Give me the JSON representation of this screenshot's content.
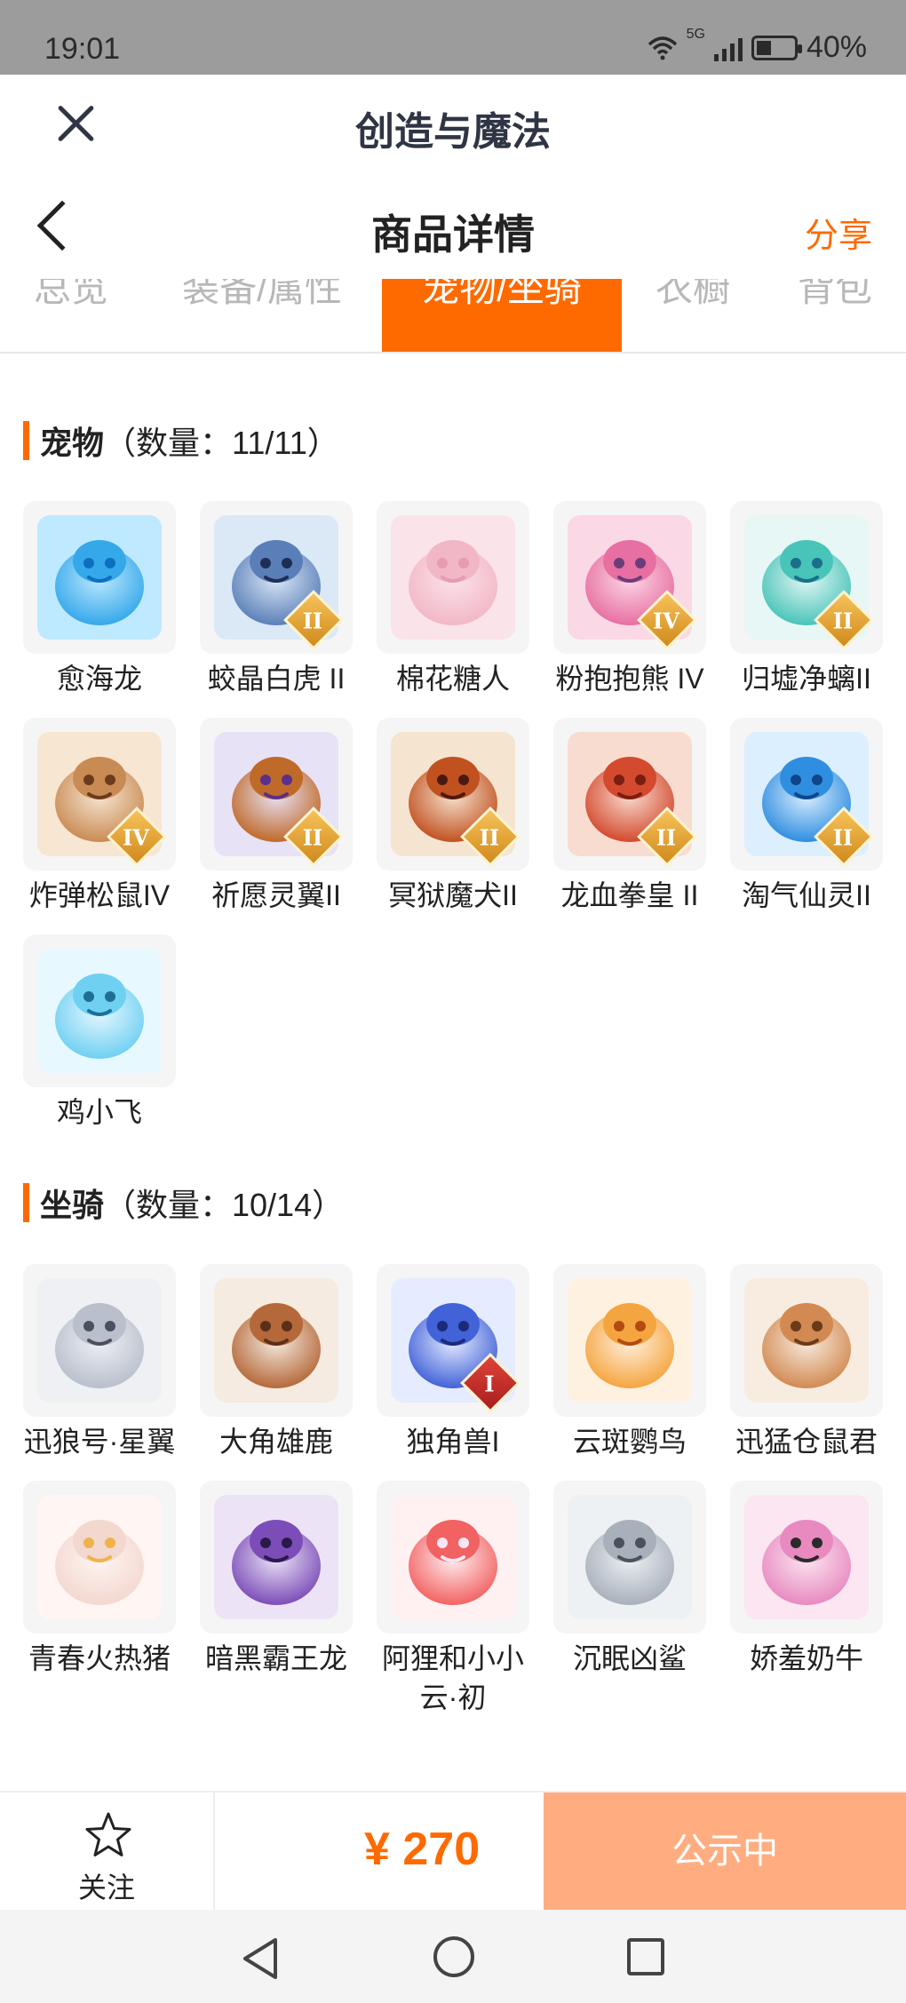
{
  "status_bar": {
    "time": "19:01",
    "network": "5G",
    "battery": "40%"
  },
  "app_header": {
    "title": "创造与魔法",
    "close_icon": "close-icon"
  },
  "page_header": {
    "title": "商品详情",
    "share": "分享",
    "back_icon": "back-chevron-icon"
  },
  "tabs": [
    {
      "label": "总览",
      "active": false
    },
    {
      "label": "装备/属性",
      "active": false
    },
    {
      "label": "宠物/坐骑",
      "active": true
    },
    {
      "label": "衣橱",
      "active": false
    },
    {
      "label": "背包",
      "active": false
    }
  ],
  "pets": {
    "title": "宠物",
    "count": "（数量：11/11）",
    "items": [
      {
        "name": "愈海龙",
        "icon": "blue-sea-dragon",
        "badge": ""
      },
      {
        "name": "蛟晶白虎 II",
        "icon": "white-tiger",
        "badge": "II"
      },
      {
        "name": "棉花糖人",
        "icon": "pink-cotton-candy-creature",
        "badge": ""
      },
      {
        "name": "粉抱抱熊 IV",
        "icon": "pink-bear",
        "badge": "IV"
      },
      {
        "name": "归墟净螭II",
        "icon": "teal-dragon",
        "badge": "II"
      },
      {
        "name": "炸弹松鼠IV",
        "icon": "squirrel",
        "badge": "IV"
      },
      {
        "name": "祈愿灵翼II",
        "icon": "eagle",
        "badge": "II"
      },
      {
        "name": "冥狱魔犬II",
        "icon": "hell-hound",
        "badge": "II"
      },
      {
        "name": "龙血拳皇 II",
        "icon": "red-demon",
        "badge": "II"
      },
      {
        "name": "淘气仙灵II",
        "icon": "blue-puppy",
        "badge": "II"
      },
      {
        "name": "鸡小飞",
        "icon": "blue-chick",
        "badge": ""
      }
    ]
  },
  "mounts": {
    "title": "坐骑",
    "count": "（数量：10/14）",
    "items": [
      {
        "name": "迅狼号·星翼",
        "icon": "mecha-wolf",
        "badge": ""
      },
      {
        "name": "大角雄鹿",
        "icon": "stag",
        "badge": ""
      },
      {
        "name": "独角兽I",
        "icon": "unicorn",
        "badge": "I"
      },
      {
        "name": "云斑鹦鸟",
        "icon": "parrot",
        "badge": ""
      },
      {
        "name": "迅猛仓鼠君",
        "icon": "hamster",
        "badge": ""
      },
      {
        "name": "青春火热猪",
        "icon": "pig",
        "badge": ""
      },
      {
        "name": "暗黑霸王龙",
        "icon": "purple-t-rex",
        "badge": ""
      },
      {
        "name": "阿狸和小小云·初",
        "icon": "red-fox-cloud",
        "badge": ""
      },
      {
        "name": "沉眠凶鲨",
        "icon": "shark",
        "badge": ""
      },
      {
        "name": "娇羞奶牛",
        "icon": "pink-cow",
        "badge": ""
      }
    ]
  },
  "bottom_bar": {
    "follow_label": "关注",
    "price": "¥ 270",
    "status": "公示中"
  },
  "colors": {
    "accent": "#ff6a00",
    "status_button": "#ffad80"
  }
}
